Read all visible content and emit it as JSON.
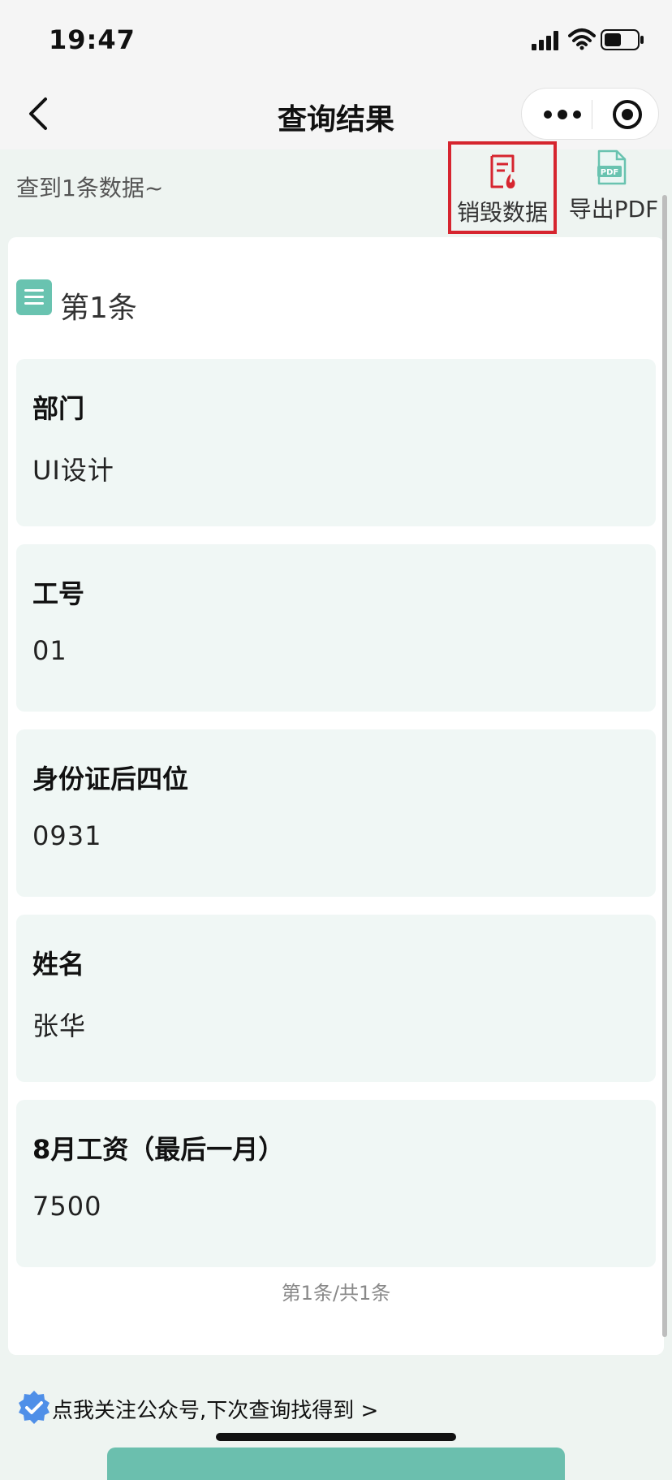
{
  "status_bar": {
    "time": "19:47"
  },
  "nav": {
    "title": "查询结果"
  },
  "summary": {
    "found_text": "查到1条数据~"
  },
  "actions": {
    "destroy_label": "销毁数据",
    "export_label": "导出PDF",
    "pdf_icon_text": "PDF"
  },
  "record": {
    "title": "第1条",
    "fields": [
      {
        "label": "部门",
        "value": "UI设计"
      },
      {
        "label": "工号",
        "value": "01"
      },
      {
        "label": "身份证后四位",
        "value": "0931"
      },
      {
        "label": "姓名",
        "value": "张华"
      },
      {
        "label": "8月工资（最后一月）",
        "value": "7500"
      }
    ]
  },
  "pager": {
    "text": "第1条/共1条"
  },
  "follow": {
    "text": "点我关注公众号,下次查询找得到 >"
  },
  "colors": {
    "accent": "#69c3b0",
    "destroy_red": "#d6252f",
    "field_bg": "#f0f7f5"
  }
}
